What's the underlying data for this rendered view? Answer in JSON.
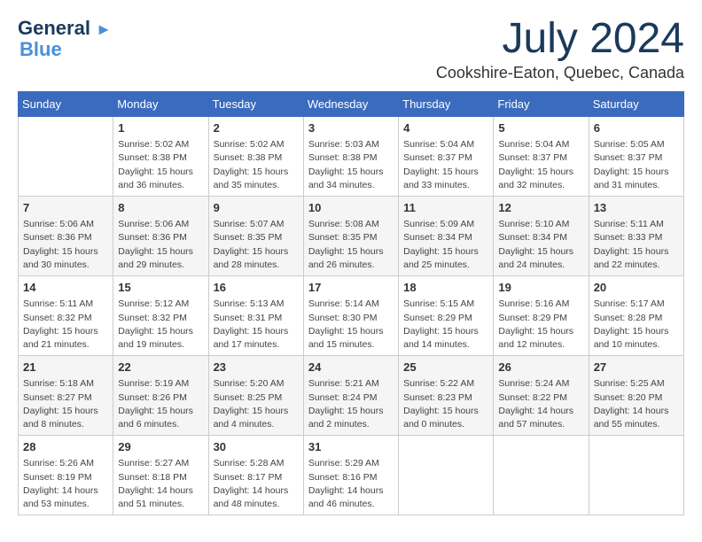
{
  "logo": {
    "line1": "General",
    "line2": "Blue"
  },
  "title": "July 2024",
  "location": "Cookshire-Eaton, Quebec, Canada",
  "days_header": [
    "Sunday",
    "Monday",
    "Tuesday",
    "Wednesday",
    "Thursday",
    "Friday",
    "Saturday"
  ],
  "weeks": [
    [
      {
        "day": "",
        "info": ""
      },
      {
        "day": "1",
        "info": "Sunrise: 5:02 AM\nSunset: 8:38 PM\nDaylight: 15 hours\nand 36 minutes."
      },
      {
        "day": "2",
        "info": "Sunrise: 5:02 AM\nSunset: 8:38 PM\nDaylight: 15 hours\nand 35 minutes."
      },
      {
        "day": "3",
        "info": "Sunrise: 5:03 AM\nSunset: 8:38 PM\nDaylight: 15 hours\nand 34 minutes."
      },
      {
        "day": "4",
        "info": "Sunrise: 5:04 AM\nSunset: 8:37 PM\nDaylight: 15 hours\nand 33 minutes."
      },
      {
        "day": "5",
        "info": "Sunrise: 5:04 AM\nSunset: 8:37 PM\nDaylight: 15 hours\nand 32 minutes."
      },
      {
        "day": "6",
        "info": "Sunrise: 5:05 AM\nSunset: 8:37 PM\nDaylight: 15 hours\nand 31 minutes."
      }
    ],
    [
      {
        "day": "7",
        "info": "Sunrise: 5:06 AM\nSunset: 8:36 PM\nDaylight: 15 hours\nand 30 minutes."
      },
      {
        "day": "8",
        "info": "Sunrise: 5:06 AM\nSunset: 8:36 PM\nDaylight: 15 hours\nand 29 minutes."
      },
      {
        "day": "9",
        "info": "Sunrise: 5:07 AM\nSunset: 8:35 PM\nDaylight: 15 hours\nand 28 minutes."
      },
      {
        "day": "10",
        "info": "Sunrise: 5:08 AM\nSunset: 8:35 PM\nDaylight: 15 hours\nand 26 minutes."
      },
      {
        "day": "11",
        "info": "Sunrise: 5:09 AM\nSunset: 8:34 PM\nDaylight: 15 hours\nand 25 minutes."
      },
      {
        "day": "12",
        "info": "Sunrise: 5:10 AM\nSunset: 8:34 PM\nDaylight: 15 hours\nand 24 minutes."
      },
      {
        "day": "13",
        "info": "Sunrise: 5:11 AM\nSunset: 8:33 PM\nDaylight: 15 hours\nand 22 minutes."
      }
    ],
    [
      {
        "day": "14",
        "info": "Sunrise: 5:11 AM\nSunset: 8:32 PM\nDaylight: 15 hours\nand 21 minutes."
      },
      {
        "day": "15",
        "info": "Sunrise: 5:12 AM\nSunset: 8:32 PM\nDaylight: 15 hours\nand 19 minutes."
      },
      {
        "day": "16",
        "info": "Sunrise: 5:13 AM\nSunset: 8:31 PM\nDaylight: 15 hours\nand 17 minutes."
      },
      {
        "day": "17",
        "info": "Sunrise: 5:14 AM\nSunset: 8:30 PM\nDaylight: 15 hours\nand 15 minutes."
      },
      {
        "day": "18",
        "info": "Sunrise: 5:15 AM\nSunset: 8:29 PM\nDaylight: 15 hours\nand 14 minutes."
      },
      {
        "day": "19",
        "info": "Sunrise: 5:16 AM\nSunset: 8:29 PM\nDaylight: 15 hours\nand 12 minutes."
      },
      {
        "day": "20",
        "info": "Sunrise: 5:17 AM\nSunset: 8:28 PM\nDaylight: 15 hours\nand 10 minutes."
      }
    ],
    [
      {
        "day": "21",
        "info": "Sunrise: 5:18 AM\nSunset: 8:27 PM\nDaylight: 15 hours\nand 8 minutes."
      },
      {
        "day": "22",
        "info": "Sunrise: 5:19 AM\nSunset: 8:26 PM\nDaylight: 15 hours\nand 6 minutes."
      },
      {
        "day": "23",
        "info": "Sunrise: 5:20 AM\nSunset: 8:25 PM\nDaylight: 15 hours\nand 4 minutes."
      },
      {
        "day": "24",
        "info": "Sunrise: 5:21 AM\nSunset: 8:24 PM\nDaylight: 15 hours\nand 2 minutes."
      },
      {
        "day": "25",
        "info": "Sunrise: 5:22 AM\nSunset: 8:23 PM\nDaylight: 15 hours\nand 0 minutes."
      },
      {
        "day": "26",
        "info": "Sunrise: 5:24 AM\nSunset: 8:22 PM\nDaylight: 14 hours\nand 57 minutes."
      },
      {
        "day": "27",
        "info": "Sunrise: 5:25 AM\nSunset: 8:20 PM\nDaylight: 14 hours\nand 55 minutes."
      }
    ],
    [
      {
        "day": "28",
        "info": "Sunrise: 5:26 AM\nSunset: 8:19 PM\nDaylight: 14 hours\nand 53 minutes."
      },
      {
        "day": "29",
        "info": "Sunrise: 5:27 AM\nSunset: 8:18 PM\nDaylight: 14 hours\nand 51 minutes."
      },
      {
        "day": "30",
        "info": "Sunrise: 5:28 AM\nSunset: 8:17 PM\nDaylight: 14 hours\nand 48 minutes."
      },
      {
        "day": "31",
        "info": "Sunrise: 5:29 AM\nSunset: 8:16 PM\nDaylight: 14 hours\nand 46 minutes."
      },
      {
        "day": "",
        "info": ""
      },
      {
        "day": "",
        "info": ""
      },
      {
        "day": "",
        "info": ""
      }
    ]
  ]
}
